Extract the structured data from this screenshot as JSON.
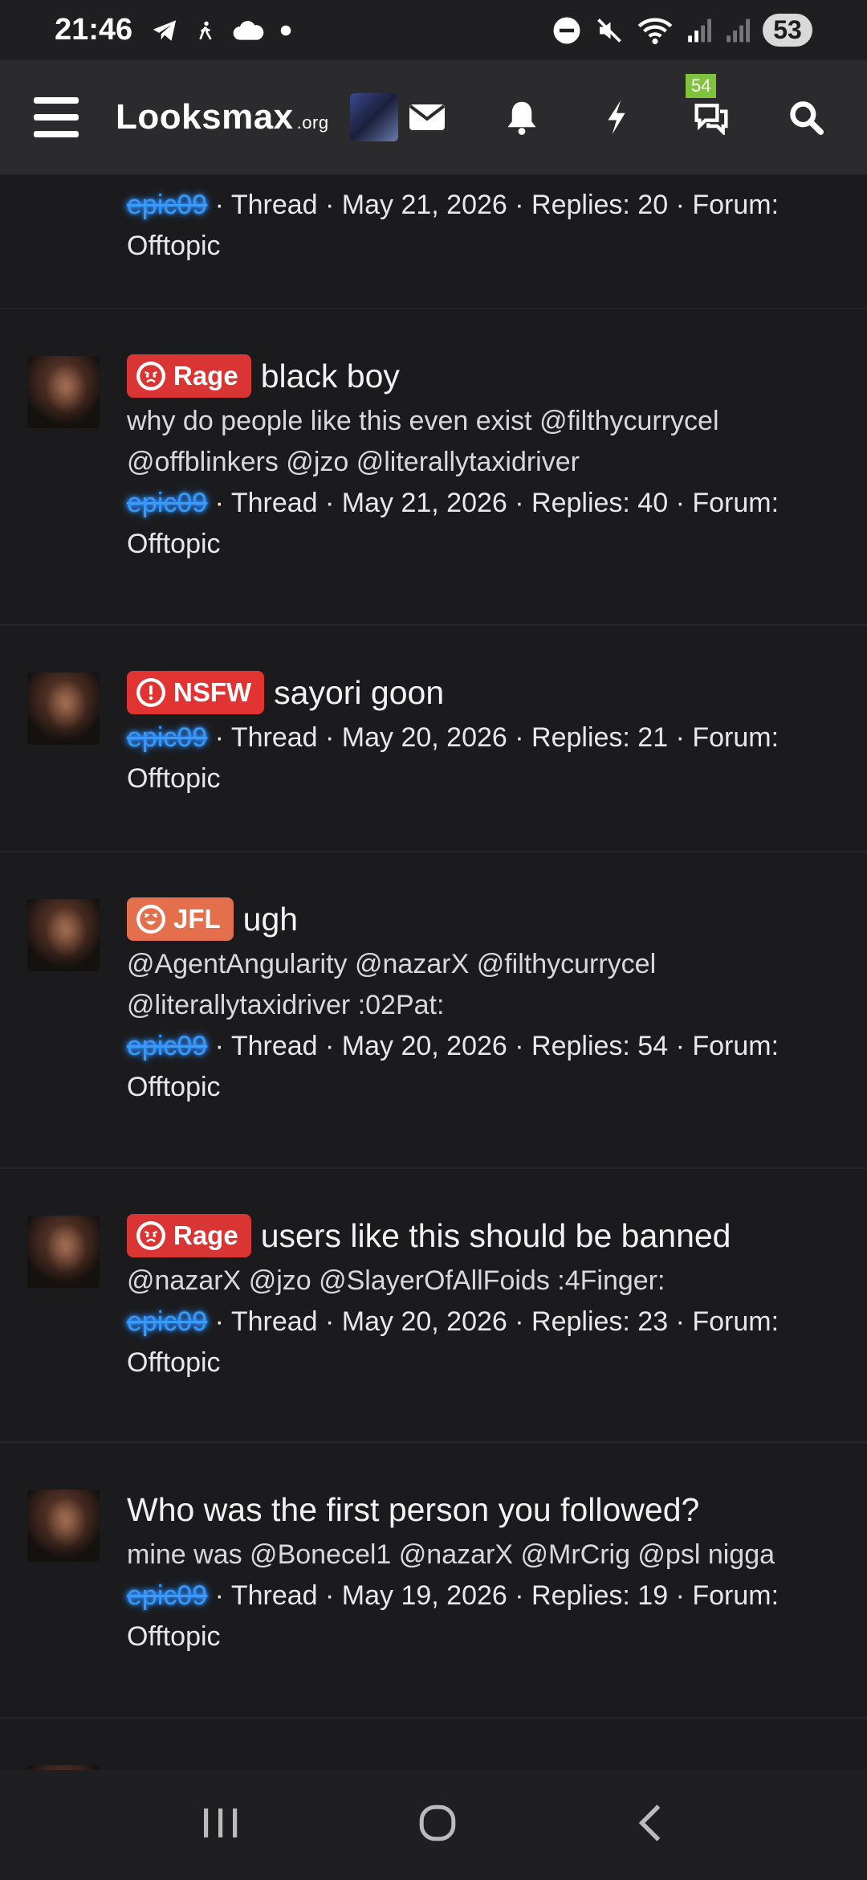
{
  "status_bar": {
    "time": "21:46",
    "battery": "53"
  },
  "header": {
    "logo_main": "Looksmax",
    "logo_suffix": ".org",
    "conversations_badge": "54"
  },
  "threads": [
    {
      "prefix": "",
      "title": "",
      "snippet": "",
      "author": "epic09",
      "meta_type": "Thread",
      "date": "May 21, 2026",
      "replies": "Replies: 20",
      "forum_label": "Forum:",
      "forum": "Offtopic"
    },
    {
      "prefix": "Rage",
      "title": "black boy",
      "snippet": "why do people like this even exist @filthycurrycel @offblinkers @jzo @literallytaxidriver",
      "author": "epic09",
      "meta_type": "Thread",
      "date": "May 21, 2026",
      "replies": "Replies: 40",
      "forum_label": "Forum:",
      "forum": "Offtopic"
    },
    {
      "prefix": "NSFW",
      "title": "sayori goon",
      "snippet": "",
      "author": "epic09",
      "meta_type": "Thread",
      "date": "May 20, 2026",
      "replies": "Replies: 21",
      "forum_label": "Forum:",
      "forum": "Offtopic"
    },
    {
      "prefix": "JFL",
      "title": "ugh",
      "snippet": "@AgentAngularity @nazarX @filthycurrycel @literallytaxidriver :02Pat:",
      "author": "epic09",
      "meta_type": "Thread",
      "date": "May 20, 2026",
      "replies": "Replies: 54",
      "forum_label": "Forum:",
      "forum": "Offtopic"
    },
    {
      "prefix": "Rage",
      "title": "users like this should be banned",
      "snippet": "@nazarX @jzo @SlayerOfAllFoids :4Finger:",
      "author": "epic09",
      "meta_type": "Thread",
      "date": "May 20, 2026",
      "replies": "Replies: 23",
      "forum_label": "Forum:",
      "forum": "Offtopic"
    },
    {
      "prefix": "",
      "title": "Who was the first person you followed?",
      "snippet": "mine was @Bonecel1 @nazarX @MrCrig @psl nigga",
      "author": "epic09",
      "meta_type": "Thread",
      "date": "May 19, 2026",
      "replies": "Replies: 19",
      "forum_label": "Forum:",
      "forum": "Offtopic"
    }
  ],
  "colors": {
    "rage": "#d93535",
    "nsfw": "#e23333",
    "jfl": "#e46f4c",
    "username": "#3a9cf5",
    "badge": "#7fc23b"
  }
}
